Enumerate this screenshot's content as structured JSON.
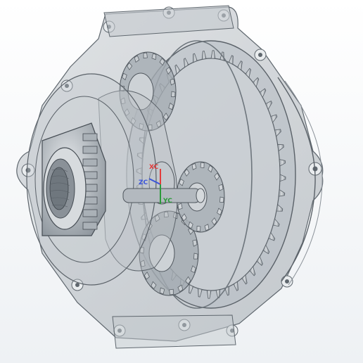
{
  "viewport": {
    "background_top": "#ffffff",
    "background_bottom": "#eef1f4"
  },
  "triad": {
    "labels": {
      "x": "XC",
      "y": "YC",
      "z": "ZC"
    },
    "colors": {
      "x": "#e23b3b",
      "y": "#2b9a3a",
      "z": "#3b55d9"
    }
  },
  "model": {
    "shell_color": "#a9b0b6",
    "shell_opacity": 0.35,
    "gear_color": "#8e969d",
    "hub_color": "#c9ced2"
  }
}
